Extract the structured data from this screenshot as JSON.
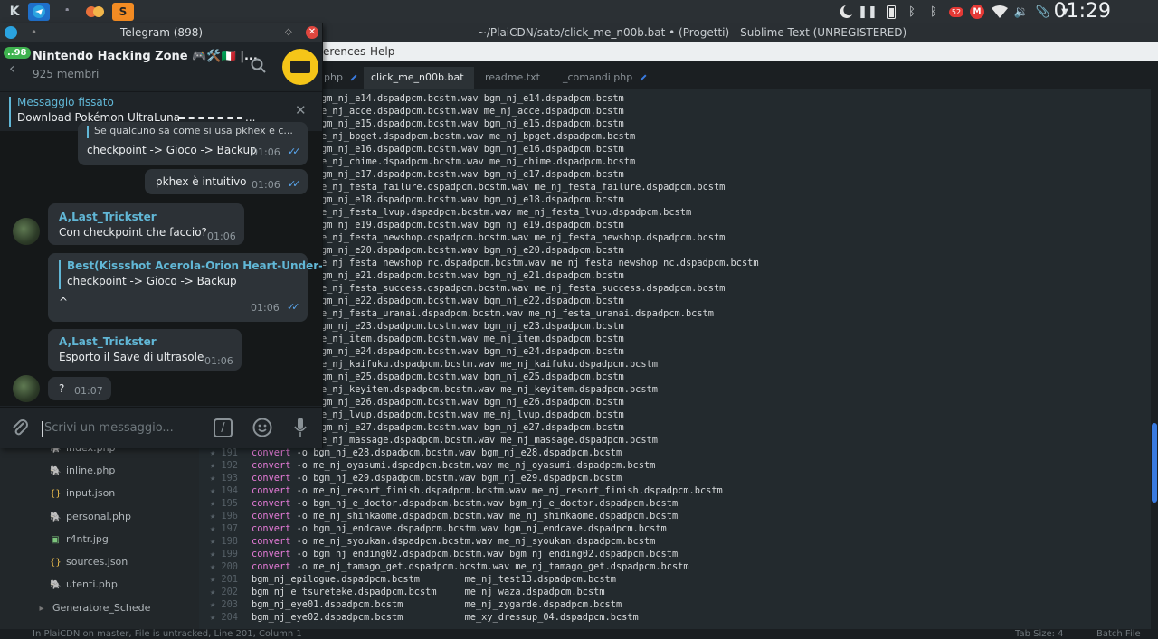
{
  "taskbar": {
    "clock": "01:29",
    "apps": [
      "kde-menu-icon",
      "telegram-icon",
      "notification-icon",
      "firefox-icon",
      "sublime-icon"
    ],
    "tray": [
      "moon-icon",
      "pause-icon",
      "battery-icon",
      "bluetooth-icon",
      "bluetooth-icon",
      "mail-badge-icon",
      "gmail-icon",
      "wifi-icon",
      "volume-icon",
      "clip-icon",
      "caret-down-icon"
    ],
    "tray_badge": "52"
  },
  "sublime": {
    "title": "~/PlaiCDN/sato/click_me_n00b.bat • (Progetti) - Sublime Text (UNREGISTERED)",
    "menu": [
      "erences",
      "Help"
    ],
    "tabs": [
      {
        "label": "php",
        "active": false
      },
      {
        "label": "click_me_n00b.bat",
        "active": true
      },
      {
        "label": "readme.txt",
        "active": false
      },
      {
        "label": "_comandi.php",
        "active": false
      }
    ],
    "sidebar_items": [
      {
        "icon": "php-file-icon",
        "label": "index.php"
      },
      {
        "icon": "php-file-icon",
        "label": "inline.php"
      },
      {
        "icon": "json-file-icon",
        "label": "input.json"
      },
      {
        "icon": "php-file-icon",
        "label": "personal.php"
      },
      {
        "icon": "image-file-icon",
        "label": "r4ntr.jpg"
      },
      {
        "icon": "json-file-icon",
        "label": "sources.json"
      },
      {
        "icon": "php-file-icon",
        "label": "utenti.php"
      },
      {
        "icon": "folder-arrow-icon",
        "label": "Generatore_Schede"
      }
    ],
    "code_lines": [
      {
        "n": "",
        "t": "gm_nj_e14.dspadpcm.bcstm.wav bgm_nj_e14.dspadpcm.bcstm"
      },
      {
        "n": "",
        "t": "e_nj_acce.dspadpcm.bcstm.wav me_nj_acce.dspadpcm.bcstm"
      },
      {
        "n": "",
        "t": "gm_nj_e15.dspadpcm.bcstm.wav bgm_nj_e15.dspadpcm.bcstm"
      },
      {
        "n": "",
        "t": "e_nj_bpget.dspadpcm.bcstm.wav me_nj_bpget.dspadpcm.bcstm"
      },
      {
        "n": "",
        "t": "gm_nj_e16.dspadpcm.bcstm.wav bgm_nj_e16.dspadpcm.bcstm"
      },
      {
        "n": "",
        "t": "e_nj_chime.dspadpcm.bcstm.wav me_nj_chime.dspadpcm.bcstm"
      },
      {
        "n": "",
        "t": "gm_nj_e17.dspadpcm.bcstm.wav bgm_nj_e17.dspadpcm.bcstm"
      },
      {
        "n": "",
        "t": "e_nj_festa_failure.dspadpcm.bcstm.wav me_nj_festa_failure.dspadpcm.bcstm"
      },
      {
        "n": "",
        "t": "gm_nj_e18.dspadpcm.bcstm.wav bgm_nj_e18.dspadpcm.bcstm"
      },
      {
        "n": "",
        "t": "e_nj_festa_lvup.dspadpcm.bcstm.wav me_nj_festa_lvup.dspadpcm.bcstm"
      },
      {
        "n": "",
        "t": "gm_nj_e19.dspadpcm.bcstm.wav bgm_nj_e19.dspadpcm.bcstm"
      },
      {
        "n": "",
        "t": "e_nj_festa_newshop.dspadpcm.bcstm.wav me_nj_festa_newshop.dspadpcm.bcstm"
      },
      {
        "n": "",
        "t": "gm_nj_e20.dspadpcm.bcstm.wav bgm_nj_e20.dspadpcm.bcstm"
      },
      {
        "n": "",
        "t": "e_nj_festa_newshop_nc.dspadpcm.bcstm.wav me_nj_festa_newshop_nc.dspadpcm.bcstm"
      },
      {
        "n": "",
        "t": "gm_nj_e21.dspadpcm.bcstm.wav bgm_nj_e21.dspadpcm.bcstm"
      },
      {
        "n": "",
        "t": "e_nj_festa_success.dspadpcm.bcstm.wav me_nj_festa_success.dspadpcm.bcstm"
      },
      {
        "n": "",
        "t": "gm_nj_e22.dspadpcm.bcstm.wav bgm_nj_e22.dspadpcm.bcstm"
      },
      {
        "n": "",
        "t": "e_nj_festa_uranai.dspadpcm.bcstm.wav me_nj_festa_uranai.dspadpcm.bcstm"
      },
      {
        "n": "",
        "t": "gm_nj_e23.dspadpcm.bcstm.wav bgm_nj_e23.dspadpcm.bcstm"
      },
      {
        "n": "",
        "t": "e_nj_item.dspadpcm.bcstm.wav me_nj_item.dspadpcm.bcstm"
      },
      {
        "n": "",
        "t": "gm_nj_e24.dspadpcm.bcstm.wav bgm_nj_e24.dspadpcm.bcstm"
      },
      {
        "n": "",
        "t": "e_nj_kaifuku.dspadpcm.bcstm.wav me_nj_kaifuku.dspadpcm.bcstm"
      },
      {
        "n": "",
        "t": "gm_nj_e25.dspadpcm.bcstm.wav bgm_nj_e25.dspadpcm.bcstm"
      },
      {
        "n": "",
        "t": "e_nj_keyitem.dspadpcm.bcstm.wav me_nj_keyitem.dspadpcm.bcstm"
      },
      {
        "n": "",
        "t": "gm_nj_e26.dspadpcm.bcstm.wav bgm_nj_e26.dspadpcm.bcstm"
      },
      {
        "n": "",
        "t": "e_nj_lvup.dspadpcm.bcstm.wav me_nj_lvup.dspadpcm.bcstm"
      },
      {
        "n": "",
        "t": "gm_nj_e27.dspadpcm.bcstm.wav bgm_nj_e27.dspadpcm.bcstm"
      },
      {
        "n": "",
        "t": "e_nj_massage.dspadpcm.bcstm.wav me_nj_massage.dspadpcm.bcstm"
      },
      {
        "n": "191",
        "t": "convert -o bgm_nj_e28.dspadpcm.bcstm.wav bgm_nj_e28.dspadpcm.bcstm"
      },
      {
        "n": "192",
        "t": "convert -o me_nj_oyasumi.dspadpcm.bcstm.wav me_nj_oyasumi.dspadpcm.bcstm"
      },
      {
        "n": "193",
        "t": "convert -o bgm_nj_e29.dspadpcm.bcstm.wav bgm_nj_e29.dspadpcm.bcstm"
      },
      {
        "n": "194",
        "t": "convert -o me_nj_resort_finish.dspadpcm.bcstm.wav me_nj_resort_finish.dspadpcm.bcstm"
      },
      {
        "n": "195",
        "t": "convert -o bgm_nj_e_doctor.dspadpcm.bcstm.wav bgm_nj_e_doctor.dspadpcm.bcstm"
      },
      {
        "n": "196",
        "t": "convert -o me_nj_shinkaome.dspadpcm.bcstm.wav me_nj_shinkaome.dspadpcm.bcstm"
      },
      {
        "n": "197",
        "t": "convert -o bgm_nj_endcave.dspadpcm.bcstm.wav bgm_nj_endcave.dspadpcm.bcstm"
      },
      {
        "n": "198",
        "t": "convert -o me_nj_syoukan.dspadpcm.bcstm.wav me_nj_syoukan.dspadpcm.bcstm"
      },
      {
        "n": "199",
        "t": "convert -o bgm_nj_ending02.dspadpcm.bcstm.wav bgm_nj_ending02.dspadpcm.bcstm"
      },
      {
        "n": "200",
        "t": "convert -o me_nj_tamago_get.dspadpcm.bcstm.wav me_nj_tamago_get.dspadpcm.bcstm"
      },
      {
        "n": "201",
        "t": "bgm_nj_epilogue.dspadpcm.bcstm        me_nj_test13.dspadpcm.bcstm"
      },
      {
        "n": "202",
        "t": "bgm_nj_e_tsureteke.dspadpcm.bcstm     me_nj_waza.dspadpcm.bcstm"
      },
      {
        "n": "203",
        "t": "bgm_nj_eye01.dspadpcm.bcstm           me_nj_zygarde.dspadpcm.bcstm"
      },
      {
        "n": "204",
        "t": "bgm_nj_eye02.dspadpcm.bcstm           me_xy_dressup_04.dspadpcm.bcstm"
      }
    ],
    "status_left": "In PlaiCDN on master, File is untracked, Line 201, Column 1",
    "status_tab": "Tab Size: 4",
    "status_syntax": "Batch File"
  },
  "telegram": {
    "window_title": "Telegram (898)",
    "unread_badge": "..98",
    "group_name": "Nintendo Hacking Zone 🎮🛠️🇮🇹 |...",
    "members": "925 membri",
    "pinned_title": "Messaggio fissato",
    "pinned_text": "Download Pokémon UltraLuna",
    "messages": {
      "m1_quote": "Se qualcuno sa come si usa pkhex e c...",
      "m1_text": "checkpoint -> Gioco -> Backup",
      "m1_time": "01:06",
      "m2_text": "pkhex è intuitivo",
      "m2_time": "01:06",
      "m3_sender": "A,Last_Trickster",
      "m3_text": "Con checkpoint che faccio?",
      "m3_time": "01:06",
      "m4_quote_name": "Best(Kissshot Acerola-Orion Heart-Under-...",
      "m4_quote_text": "checkpoint -> Gioco -> Backup",
      "m4_text": "^",
      "m4_time": "01:06",
      "m5_sender": "A,Last_Trickster",
      "m5_text": "Esporto il Save di ultrasole",
      "m5_time": "01:06",
      "m6_text": "?",
      "m6_time": "01:07"
    },
    "input_placeholder": "Scrivi un messaggio..."
  },
  "colors": {
    "accent": "#3a7be0",
    "keyword": "#e37ad6",
    "sender": "#61b7d6",
    "ticks": "#5aa7ee"
  }
}
